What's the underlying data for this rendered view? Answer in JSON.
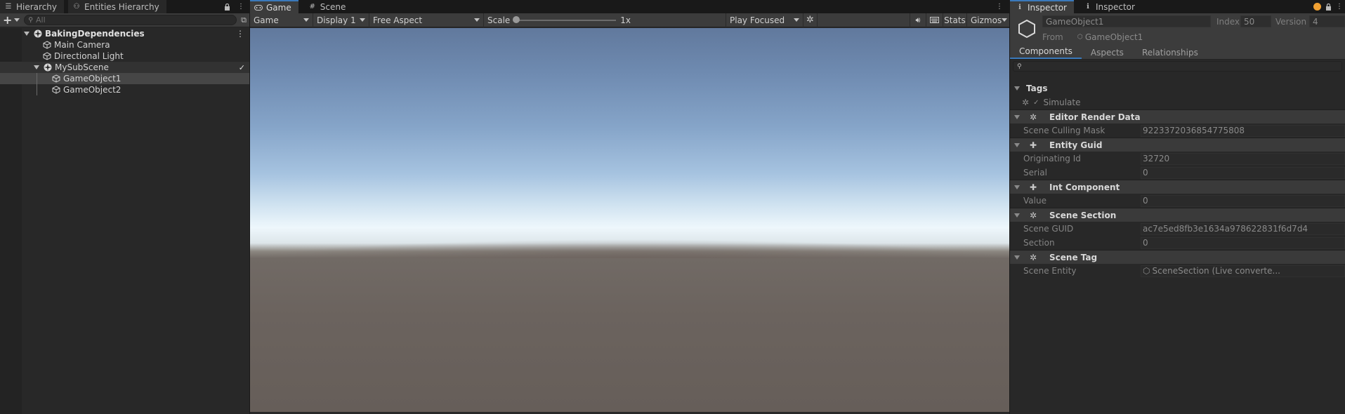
{
  "hierarchy": {
    "tabs": [
      {
        "label": "Hierarchy",
        "icon": "list-icon"
      },
      {
        "label": "Entities Hierarchy",
        "icon": "entities-icon"
      }
    ],
    "search_placeholder": "All",
    "items": [
      {
        "label": "BakingDependencies",
        "icon": "unity-scene-icon"
      },
      {
        "label": "Main Camera",
        "icon": "cube-icon"
      },
      {
        "label": "Directional Light",
        "icon": "cube-icon"
      },
      {
        "label": "MySubScene",
        "icon": "unity-scene-icon"
      },
      {
        "label": "GameObject1",
        "icon": "cube-icon"
      },
      {
        "label": "GameObject2",
        "icon": "cube-icon"
      }
    ],
    "checkmark": "✓"
  },
  "game": {
    "tabs": [
      {
        "label": "Game",
        "icon": "gamepad-icon"
      },
      {
        "label": "Scene",
        "icon": "grid-icon"
      }
    ],
    "toolbar": {
      "view_mode": "Game",
      "display": "Display 1",
      "aspect": "Free Aspect",
      "scale_label": "Scale",
      "scale_value": "1x",
      "play_mode": "Play Focused",
      "stats": "Stats",
      "gizmos": "Gizmos"
    }
  },
  "inspector": {
    "tabs": [
      {
        "label": "Inspector",
        "icon": "info-icon"
      },
      {
        "label": "Inspector",
        "icon": "info-icon"
      }
    ],
    "entity": {
      "name": "GameObject1",
      "index_label": "Index",
      "index_value": "50",
      "version_label": "Version",
      "version_value": "4",
      "from_label": "From",
      "from_value": "GameObject1"
    },
    "subtabs": [
      "Components",
      "Aspects",
      "Relationships"
    ],
    "tags_header": "Tags",
    "tags": [
      "Simulate"
    ],
    "components": [
      {
        "name": "Editor Render Data",
        "props": [
          {
            "label": "Scene Culling Mask",
            "value": "9223372036854775808"
          }
        ]
      },
      {
        "name": "Entity Guid",
        "props": [
          {
            "label": "Originating Id",
            "value": "32720"
          },
          {
            "label": "Serial",
            "value": "0"
          }
        ]
      },
      {
        "name": "Int Component",
        "props": [
          {
            "label": "Value",
            "value": "0"
          }
        ]
      },
      {
        "name": "Scene Section",
        "props": [
          {
            "label": "Scene GUID",
            "value": "ac7e5ed8fb3e1634a978622831f6d7d4"
          },
          {
            "label": "Section",
            "value": "0"
          }
        ]
      },
      {
        "name": "Scene Tag",
        "props": [
          {
            "label": "Scene Entity",
            "value": "SceneSection (Live converte..."
          }
        ]
      }
    ]
  },
  "colors": {
    "accent": "#3a79bb",
    "panel": "#282828",
    "toolbar": "#3c3c3c",
    "status_dot": "#f0a032"
  }
}
